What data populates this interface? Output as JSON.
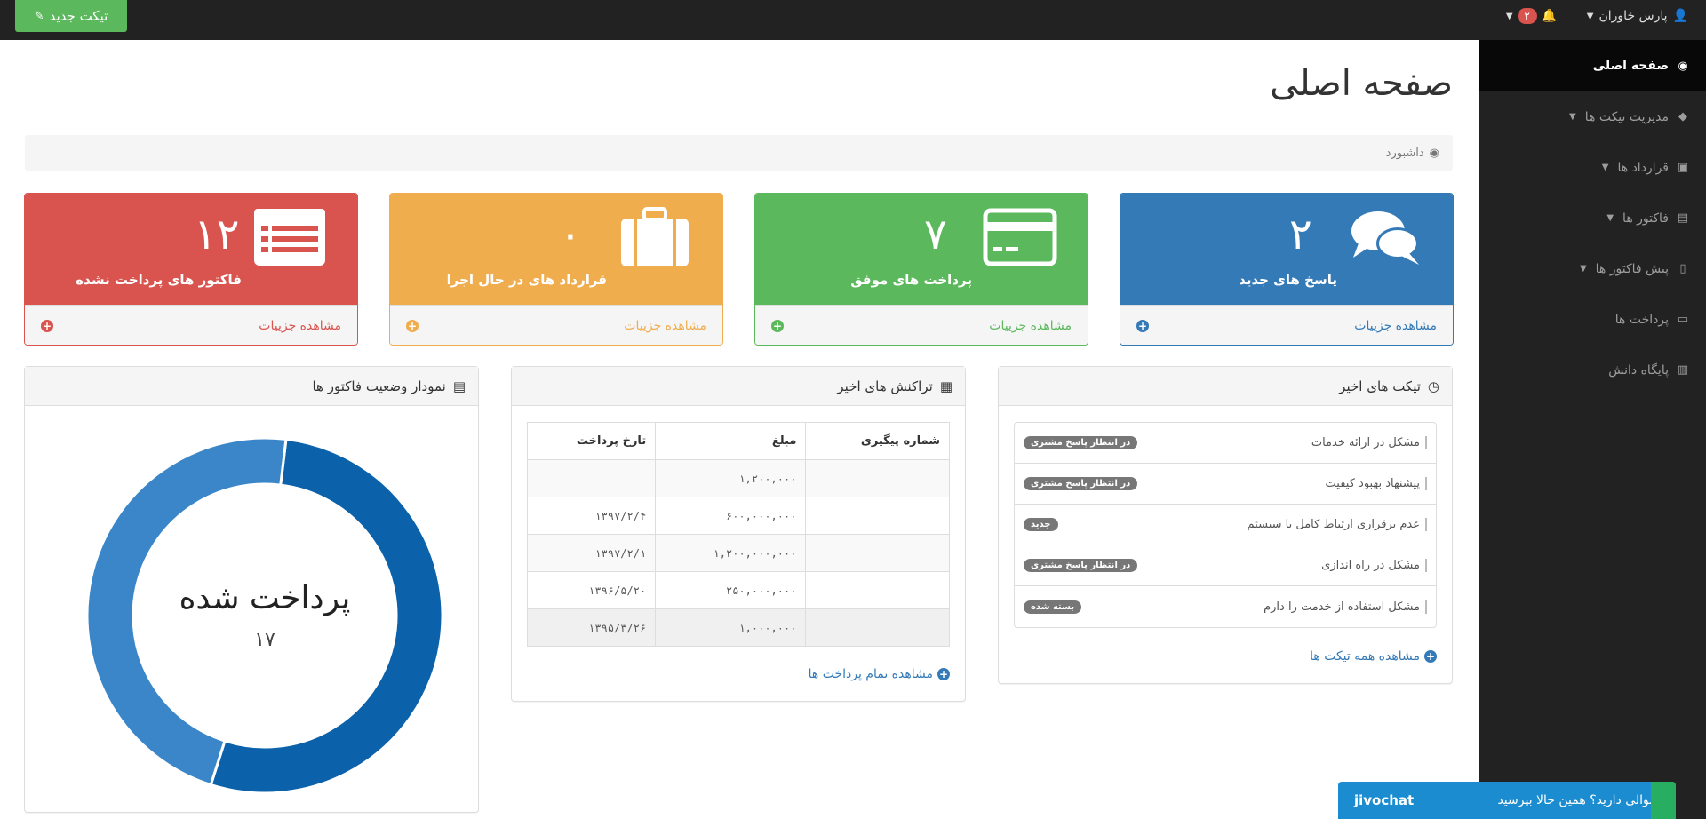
{
  "topbar": {
    "new_ticket_label": "تیکت جدید",
    "user_name": "پارس خاوران",
    "notification_count": "۲"
  },
  "sidebar": {
    "items": [
      {
        "label": "صفحه اصلی",
        "icon": "dashboard-icon",
        "active": true
      },
      {
        "label": "مدیریت تیکت ها",
        "icon": "ticket-icon",
        "caret": true
      },
      {
        "label": "قرارداد ها",
        "icon": "briefcase-icon",
        "caret": true
      },
      {
        "label": "فاکتور ها",
        "icon": "invoice-icon",
        "caret": true
      },
      {
        "label": "پیش فاکتور ها",
        "icon": "file-icon",
        "caret": true
      },
      {
        "label": "پرداخت ها",
        "icon": "credit-card-icon"
      },
      {
        "label": "پایگاه دانش",
        "icon": "book-icon"
      }
    ]
  },
  "page": {
    "title": "صفحه اصلی",
    "breadcrumb": "داشبورد"
  },
  "stats": [
    {
      "value": "۲",
      "label": "پاسخ های جدید",
      "link": "مشاهده جزییات",
      "color": "#337ab7",
      "icon": "comments-icon"
    },
    {
      "value": "۷",
      "label": "پرداخت های موفق",
      "link": "مشاهده جزییات",
      "color": "#5cb85c",
      "icon": "credit-card-icon"
    },
    {
      "value": "۰",
      "label": "قرارداد های در حال اجرا",
      "link": "مشاهده جزییات",
      "color": "#f0ad4e",
      "icon": "suitcase-icon"
    },
    {
      "value": "۱۲",
      "label": "فاکتور های پرداخت نشده",
      "link": "مشاهده جزییات",
      "color": "#d9534f",
      "icon": "list-icon"
    }
  ],
  "tickets": {
    "title": "تیکت های اخیر",
    "rows": [
      {
        "title": "مشکل در ارائه خدمات",
        "status": "در انتظار پاسخ مشتری"
      },
      {
        "title": "پیشنهاد بهبود کیفیت",
        "status": "در انتظار پاسخ مشتری"
      },
      {
        "title": "عدم برقراری ارتباط کامل با سیستم",
        "status": "جدید"
      },
      {
        "title": "مشکل در راه اندازی",
        "status": "در انتظار پاسخ مشتری"
      },
      {
        "title": "مشکل استفاده از خدمت را دارم",
        "status": "بسته شده"
      }
    ],
    "view_all": "مشاهده همه تیکت ها"
  },
  "transactions": {
    "title": "تراکنش های اخیر",
    "columns": [
      "شماره پیگیری",
      "مبلغ",
      "تارخ پرداخت"
    ],
    "rows": [
      [
        "",
        "۱,۲۰۰,۰۰۰",
        ""
      ],
      [
        "",
        "۶۰۰,۰۰۰,۰۰۰",
        "۱۳۹۷/۲/۴"
      ],
      [
        "",
        "۱,۲۰۰,۰۰۰,۰۰۰",
        "۱۳۹۷/۲/۱"
      ],
      [
        "",
        "۲۵۰,۰۰۰,۰۰۰",
        "۱۳۹۶/۵/۲۰"
      ],
      [
        "",
        "۱,۰۰۰,۰۰۰",
        "۱۳۹۵/۳/۲۶"
      ]
    ],
    "view_all": "مشاهده تمام پرداخت ها"
  },
  "chart_panel": {
    "title": "نمودار وضعیت فاکتور ها"
  },
  "chart_data": {
    "type": "pie",
    "center_label": "پرداخت شده",
    "center_value": "۱۷",
    "slices": [
      {
        "value": 53,
        "color": "#0b62aa"
      },
      {
        "value": 47,
        "color": "#3a86c8"
      }
    ]
  },
  "chat": {
    "brand": "jivochat",
    "message": "سوالی دارید؟ همین حالا بپرسید"
  }
}
